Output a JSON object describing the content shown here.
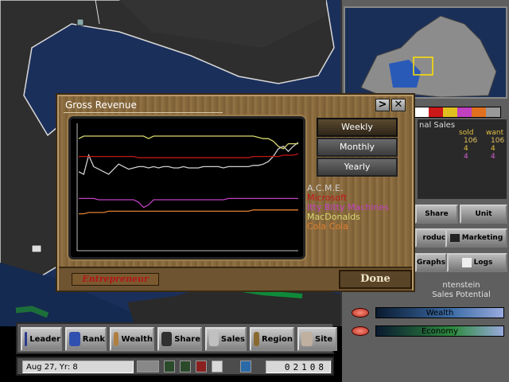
{
  "dialog": {
    "title": "Gross Revenue",
    "next_label": ">",
    "close_label": "✕",
    "period_buttons": [
      "Weekly",
      "Monthly",
      "Yearly"
    ],
    "active_period": "Weekly",
    "rank": "Entrepreneur",
    "done_label": "Done"
  },
  "chart_data": {
    "type": "line",
    "title": "Gross Revenue",
    "xlabel": "",
    "ylabel": "",
    "grid": false,
    "legend_position": "right",
    "ylim": [
      0,
      100
    ],
    "series": [
      {
        "name": "A.C.M.E.",
        "color": "#cfcfcf",
        "values": [
          62,
          60,
          75,
          66,
          64,
          62,
          60,
          64,
          68,
          66,
          64,
          65,
          66,
          66,
          65,
          66,
          65,
          66,
          66,
          65,
          65,
          66,
          65,
          65,
          65,
          66,
          66,
          66,
          66,
          65,
          66,
          66,
          66,
          66,
          66,
          67,
          67,
          68,
          70,
          74,
          80,
          82,
          78,
          82,
          85
        ]
      },
      {
        "name": "Microsoft",
        "color": "#c01818",
        "values": [
          74,
          74,
          74,
          74,
          74,
          74,
          74,
          74,
          74,
          74,
          74,
          74,
          73,
          73,
          73,
          73,
          73,
          73,
          73,
          73,
          73,
          73,
          73,
          73,
          73,
          73,
          73,
          73,
          73,
          73,
          73,
          73,
          73,
          73,
          73,
          74,
          74,
          74,
          74,
          74,
          74,
          75,
          75,
          75,
          76
        ]
      },
      {
        "name": "Itty Bitty Machines",
        "color": "#c040c0",
        "values": [
          41,
          41,
          41,
          41,
          40,
          40,
          40,
          40,
          40,
          40,
          40,
          40,
          38,
          34,
          36,
          40,
          40,
          40,
          40,
          40,
          40,
          40,
          40,
          40,
          40,
          40,
          40,
          40,
          40,
          40,
          41,
          41,
          41,
          41,
          41,
          41,
          41,
          41,
          41,
          41,
          41,
          41,
          41,
          41,
          41
        ]
      },
      {
        "name": "MacDonalds",
        "color": "#d8d870",
        "values": [
          88,
          90,
          90,
          90,
          90,
          90,
          90,
          90,
          90,
          90,
          90,
          90,
          90,
          90,
          88,
          90,
          90,
          90,
          90,
          90,
          90,
          90,
          90,
          90,
          90,
          90,
          90,
          90,
          90,
          90,
          90,
          90,
          90,
          90,
          90,
          90,
          89,
          88,
          88,
          86,
          82,
          80,
          84,
          84,
          84
        ]
      },
      {
        "name": "Cola Cola",
        "color": "#e08030",
        "values": [
          29,
          29,
          30,
          30,
          30,
          30,
          31,
          31,
          31,
          31,
          31,
          31,
          31,
          31,
          31,
          31,
          31,
          31,
          31,
          31,
          31,
          31,
          31,
          31,
          31,
          31,
          31,
          31,
          31,
          31,
          31,
          31,
          31,
          31,
          31,
          32,
          32,
          32,
          32,
          32,
          32,
          32,
          32,
          32,
          32
        ]
      }
    ]
  },
  "right_panel": {
    "sales_title": "nal Sales",
    "col_sold": "sold",
    "col_want": "want",
    "rows": [
      {
        "sold": "106",
        "want": "106",
        "color": "#e0c060"
      },
      {
        "sold": "4",
        "want": "4",
        "color": "#e0c040"
      },
      {
        "sold": "4",
        "want": "4",
        "color": "#d060d0"
      }
    ],
    "buttons": {
      "unit": "Unit",
      "share": "Share",
      "produce": "roduce",
      "marketing": "Marketing",
      "graphs": "Graphs",
      "logs": "Logs"
    },
    "region_name": "ntenstein",
    "region_sub": "Sales Potential",
    "meters": [
      {
        "label": "Wealth",
        "color": "#3e6ea8"
      },
      {
        "label": "Economy",
        "color": "#2e8a3e"
      }
    ],
    "strip_colors": [
      "#ffffff",
      "#cc1818",
      "#e0c020",
      "#c040c0",
      "#e07020",
      "#999999"
    ]
  },
  "toolbar": {
    "buttons": [
      {
        "label": "Leader",
        "icon": "leader-icon",
        "color": "#2a3a8a"
      },
      {
        "label": "Rank",
        "icon": "rank-ribbon-icon",
        "color": "#3050b0"
      },
      {
        "label": "Wealth",
        "icon": "money-bag-icon",
        "color": "#b08040"
      },
      {
        "label": "Share",
        "icon": "share-icon",
        "color": "#303030"
      },
      {
        "label": "Sales",
        "icon": "sales-icon",
        "color": "#c0c0c0"
      },
      {
        "label": "Region",
        "icon": "globe-icon",
        "color": "#8a6a30"
      },
      {
        "label": "Site",
        "icon": "site-icon",
        "color": "#c0b0a0"
      }
    ]
  },
  "status": {
    "date": "Aug 27, Yr: 8",
    "money": "02108"
  }
}
